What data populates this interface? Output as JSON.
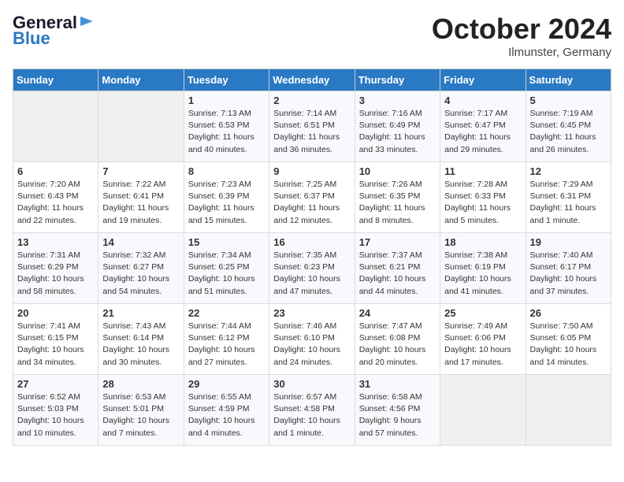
{
  "header": {
    "logo_line1": "General",
    "logo_line2": "Blue",
    "month": "October 2024",
    "location": "Ilmunster, Germany"
  },
  "weekdays": [
    "Sunday",
    "Monday",
    "Tuesday",
    "Wednesday",
    "Thursday",
    "Friday",
    "Saturday"
  ],
  "weeks": [
    [
      {
        "day": "",
        "empty": true
      },
      {
        "day": "",
        "empty": true
      },
      {
        "day": "1",
        "detail": "Sunrise: 7:13 AM\nSunset: 6:53 PM\nDaylight: 11 hours and 40 minutes."
      },
      {
        "day": "2",
        "detail": "Sunrise: 7:14 AM\nSunset: 6:51 PM\nDaylight: 11 hours and 36 minutes."
      },
      {
        "day": "3",
        "detail": "Sunrise: 7:16 AM\nSunset: 6:49 PM\nDaylight: 11 hours and 33 minutes."
      },
      {
        "day": "4",
        "detail": "Sunrise: 7:17 AM\nSunset: 6:47 PM\nDaylight: 11 hours and 29 minutes."
      },
      {
        "day": "5",
        "detail": "Sunrise: 7:19 AM\nSunset: 6:45 PM\nDaylight: 11 hours and 26 minutes."
      }
    ],
    [
      {
        "day": "6",
        "detail": "Sunrise: 7:20 AM\nSunset: 6:43 PM\nDaylight: 11 hours and 22 minutes."
      },
      {
        "day": "7",
        "detail": "Sunrise: 7:22 AM\nSunset: 6:41 PM\nDaylight: 11 hours and 19 minutes."
      },
      {
        "day": "8",
        "detail": "Sunrise: 7:23 AM\nSunset: 6:39 PM\nDaylight: 11 hours and 15 minutes."
      },
      {
        "day": "9",
        "detail": "Sunrise: 7:25 AM\nSunset: 6:37 PM\nDaylight: 11 hours and 12 minutes."
      },
      {
        "day": "10",
        "detail": "Sunrise: 7:26 AM\nSunset: 6:35 PM\nDaylight: 11 hours and 8 minutes."
      },
      {
        "day": "11",
        "detail": "Sunrise: 7:28 AM\nSunset: 6:33 PM\nDaylight: 11 hours and 5 minutes."
      },
      {
        "day": "12",
        "detail": "Sunrise: 7:29 AM\nSunset: 6:31 PM\nDaylight: 11 hours and 1 minute."
      }
    ],
    [
      {
        "day": "13",
        "detail": "Sunrise: 7:31 AM\nSunset: 6:29 PM\nDaylight: 10 hours and 58 minutes."
      },
      {
        "day": "14",
        "detail": "Sunrise: 7:32 AM\nSunset: 6:27 PM\nDaylight: 10 hours and 54 minutes."
      },
      {
        "day": "15",
        "detail": "Sunrise: 7:34 AM\nSunset: 6:25 PM\nDaylight: 10 hours and 51 minutes."
      },
      {
        "day": "16",
        "detail": "Sunrise: 7:35 AM\nSunset: 6:23 PM\nDaylight: 10 hours and 47 minutes."
      },
      {
        "day": "17",
        "detail": "Sunrise: 7:37 AM\nSunset: 6:21 PM\nDaylight: 10 hours and 44 minutes."
      },
      {
        "day": "18",
        "detail": "Sunrise: 7:38 AM\nSunset: 6:19 PM\nDaylight: 10 hours and 41 minutes."
      },
      {
        "day": "19",
        "detail": "Sunrise: 7:40 AM\nSunset: 6:17 PM\nDaylight: 10 hours and 37 minutes."
      }
    ],
    [
      {
        "day": "20",
        "detail": "Sunrise: 7:41 AM\nSunset: 6:15 PM\nDaylight: 10 hours and 34 minutes."
      },
      {
        "day": "21",
        "detail": "Sunrise: 7:43 AM\nSunset: 6:14 PM\nDaylight: 10 hours and 30 minutes."
      },
      {
        "day": "22",
        "detail": "Sunrise: 7:44 AM\nSunset: 6:12 PM\nDaylight: 10 hours and 27 minutes."
      },
      {
        "day": "23",
        "detail": "Sunrise: 7:46 AM\nSunset: 6:10 PM\nDaylight: 10 hours and 24 minutes."
      },
      {
        "day": "24",
        "detail": "Sunrise: 7:47 AM\nSunset: 6:08 PM\nDaylight: 10 hours and 20 minutes."
      },
      {
        "day": "25",
        "detail": "Sunrise: 7:49 AM\nSunset: 6:06 PM\nDaylight: 10 hours and 17 minutes."
      },
      {
        "day": "26",
        "detail": "Sunrise: 7:50 AM\nSunset: 6:05 PM\nDaylight: 10 hours and 14 minutes."
      }
    ],
    [
      {
        "day": "27",
        "detail": "Sunrise: 6:52 AM\nSunset: 5:03 PM\nDaylight: 10 hours and 10 minutes."
      },
      {
        "day": "28",
        "detail": "Sunrise: 6:53 AM\nSunset: 5:01 PM\nDaylight: 10 hours and 7 minutes."
      },
      {
        "day": "29",
        "detail": "Sunrise: 6:55 AM\nSunset: 4:59 PM\nDaylight: 10 hours and 4 minutes."
      },
      {
        "day": "30",
        "detail": "Sunrise: 6:57 AM\nSunset: 4:58 PM\nDaylight: 10 hours and 1 minute."
      },
      {
        "day": "31",
        "detail": "Sunrise: 6:58 AM\nSunset: 4:56 PM\nDaylight: 9 hours and 57 minutes."
      },
      {
        "day": "",
        "empty": true
      },
      {
        "day": "",
        "empty": true
      }
    ]
  ]
}
